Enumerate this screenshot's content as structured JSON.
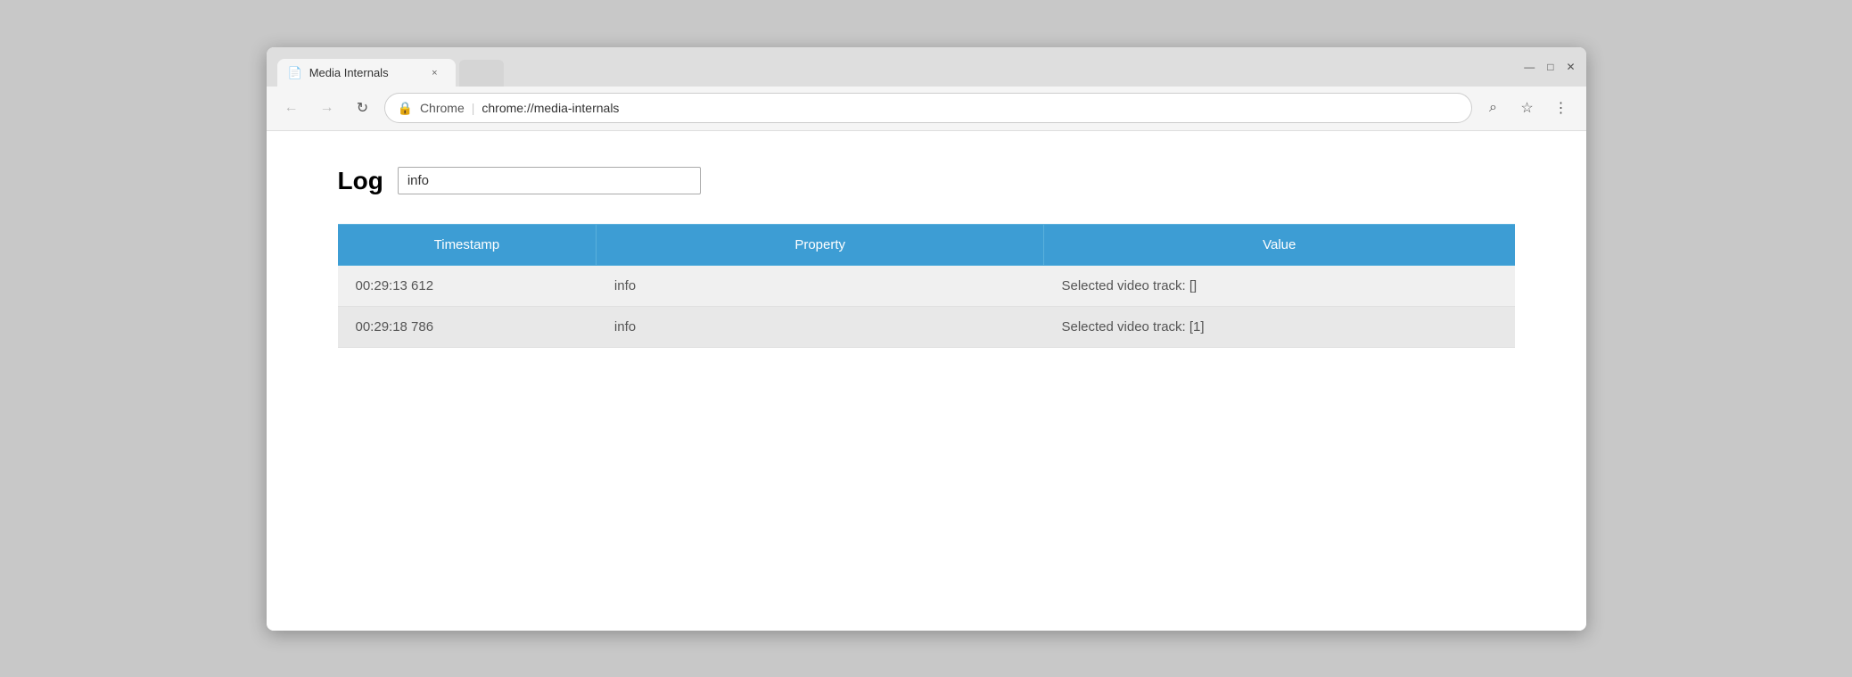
{
  "window": {
    "title": "Media Internals",
    "controls": {
      "minimize": "—",
      "maximize": "□",
      "close": "✕"
    }
  },
  "tab": {
    "label": "Media Internals",
    "close": "×"
  },
  "toolbar": {
    "back_label": "←",
    "forward_label": "→",
    "reload_label": "↻",
    "address_icon": "🔒",
    "address_prefix": "Chrome",
    "address_url": "chrome://media-internals",
    "search_label": "⌕",
    "bookmark_label": "☆",
    "menu_label": "⋮"
  },
  "log_section": {
    "label": "Log",
    "input_value": "info"
  },
  "table": {
    "headers": [
      "Timestamp",
      "Property",
      "Value"
    ],
    "rows": [
      {
        "timestamp": "00:29:13 612",
        "property": "info",
        "value": "Selected video track: []"
      },
      {
        "timestamp": "00:29:18 786",
        "property": "info",
        "value": "Selected video track: [1]"
      }
    ]
  }
}
